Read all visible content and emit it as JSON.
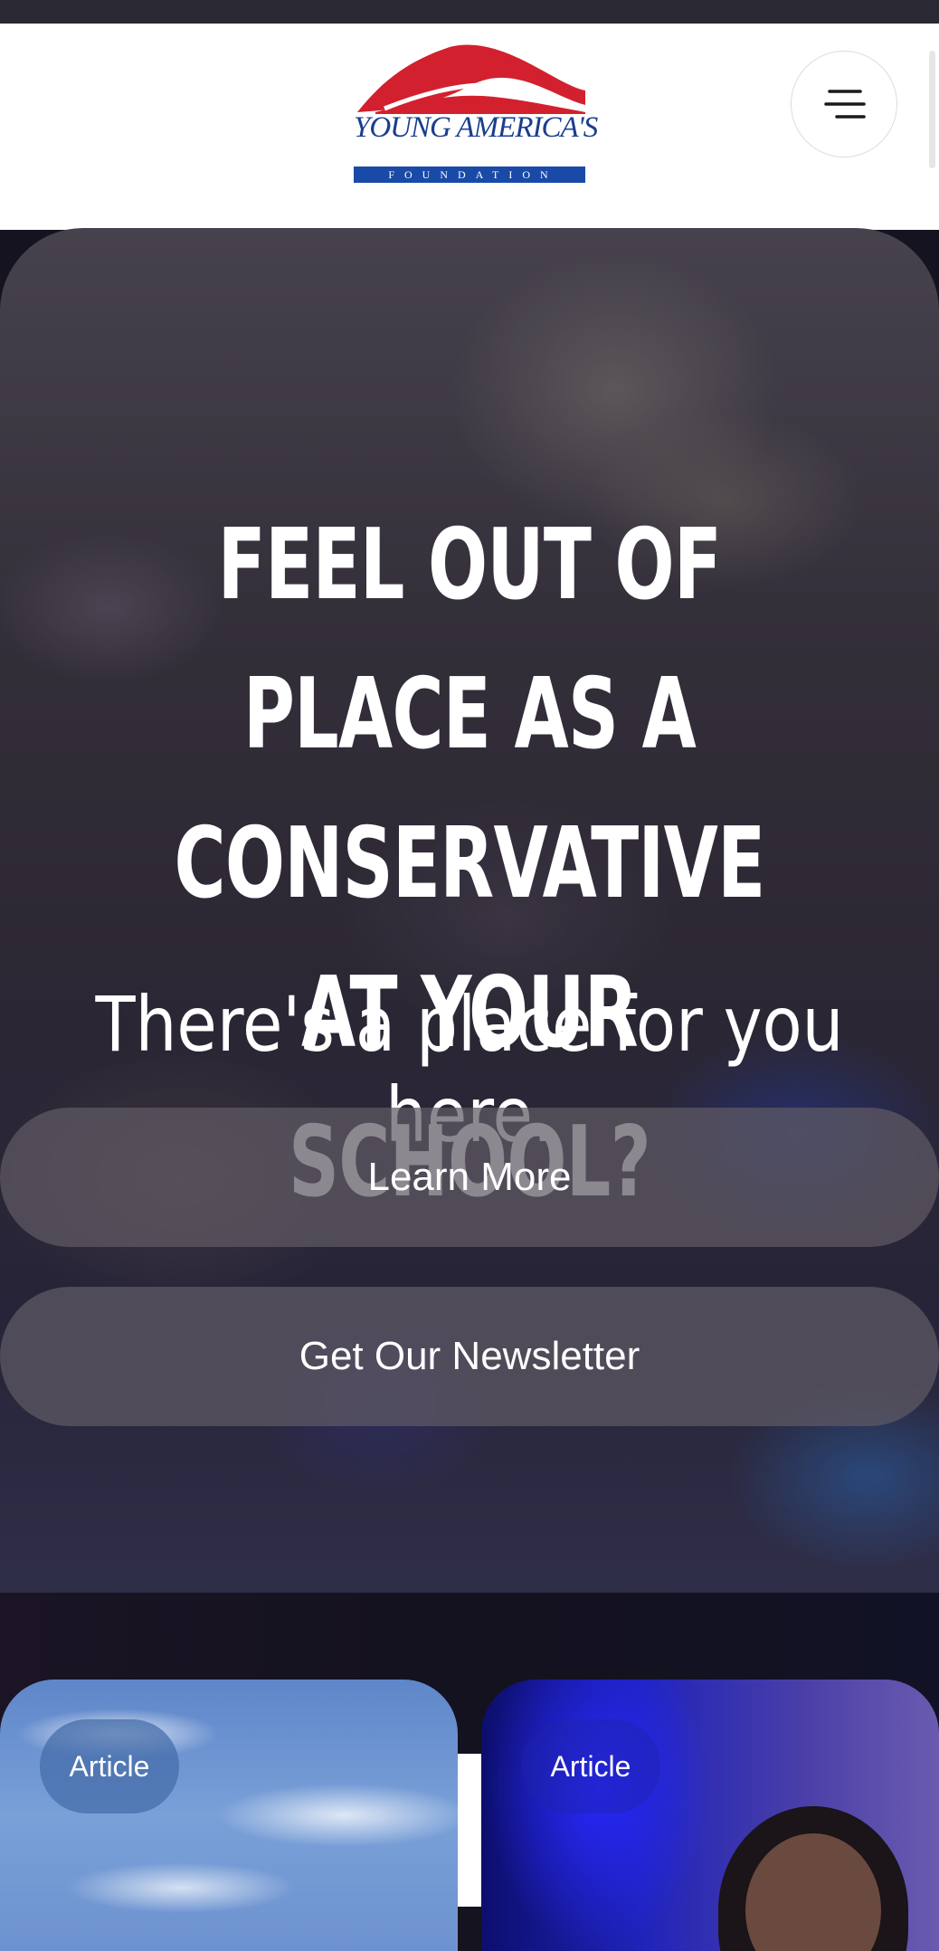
{
  "header": {
    "logo_text": "YOUNG AMERICA'S",
    "logo_subtext": "FOUNDATION",
    "menu_icon": "menu-icon"
  },
  "hero": {
    "title": "FEEL OUT OF PLACE AS A CONSERVATIVE AT YOUR SCHOOL?",
    "subtitle": "There's a place for you here.",
    "learn_more_label": "Learn More",
    "newsletter_label": "Get Our Newsletter"
  },
  "cards": [
    {
      "badge": "Article"
    },
    {
      "badge": "Article"
    }
  ],
  "colors": {
    "logo_red": "#d3202e",
    "logo_blue": "#1a3d8f",
    "page_dark": "#15131f",
    "button_fill": "#5f5a64"
  }
}
